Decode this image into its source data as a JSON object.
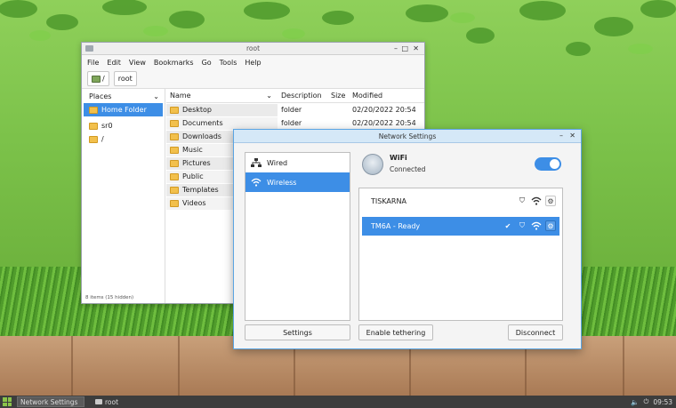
{
  "file_manager": {
    "title": "root",
    "menu": [
      "File",
      "Edit",
      "View",
      "Bookmarks",
      "Go",
      "Tools",
      "Help"
    ],
    "path_root": "/",
    "path_current": "root",
    "places_header": "Places",
    "places": [
      "Home Folder",
      "sr0",
      "/"
    ],
    "columns": {
      "name": "Name",
      "description": "Description",
      "size": "Size",
      "modified": "Modified"
    },
    "files": [
      {
        "name": "Desktop",
        "description": "folder",
        "modified": "02/20/2022 20:54"
      },
      {
        "name": "Documents",
        "description": "folder",
        "modified": "02/20/2022 20:54"
      },
      {
        "name": "Downloads",
        "description": "folder",
        "modified": ""
      },
      {
        "name": "Music",
        "description": "",
        "modified": ""
      },
      {
        "name": "Pictures",
        "description": "",
        "modified": ""
      },
      {
        "name": "Public",
        "description": "",
        "modified": ""
      },
      {
        "name": "Templates",
        "description": "",
        "modified": ""
      },
      {
        "name": "Videos",
        "description": "",
        "modified": ""
      }
    ],
    "status": "8 items (15 hidden)"
  },
  "network_settings": {
    "title": "Network Settings",
    "sidebar": [
      "Wired",
      "Wireless"
    ],
    "wifi_label": "WiFi",
    "wifi_status": "Connected",
    "wifi_enabled": true,
    "networks": [
      {
        "name": "TISKARNA",
        "connected": false
      },
      {
        "name": "TM6A - Ready",
        "connected": true
      }
    ],
    "buttons": {
      "settings": "Settings",
      "tethering": "Enable tethering",
      "disconnect": "Disconnect"
    }
  },
  "taskbar": {
    "items": [
      "Network Settings",
      "root"
    ],
    "clock": "09:53"
  },
  "colors": {
    "accent": "#3d8ee6",
    "taskbar": "#3d3d3d"
  }
}
